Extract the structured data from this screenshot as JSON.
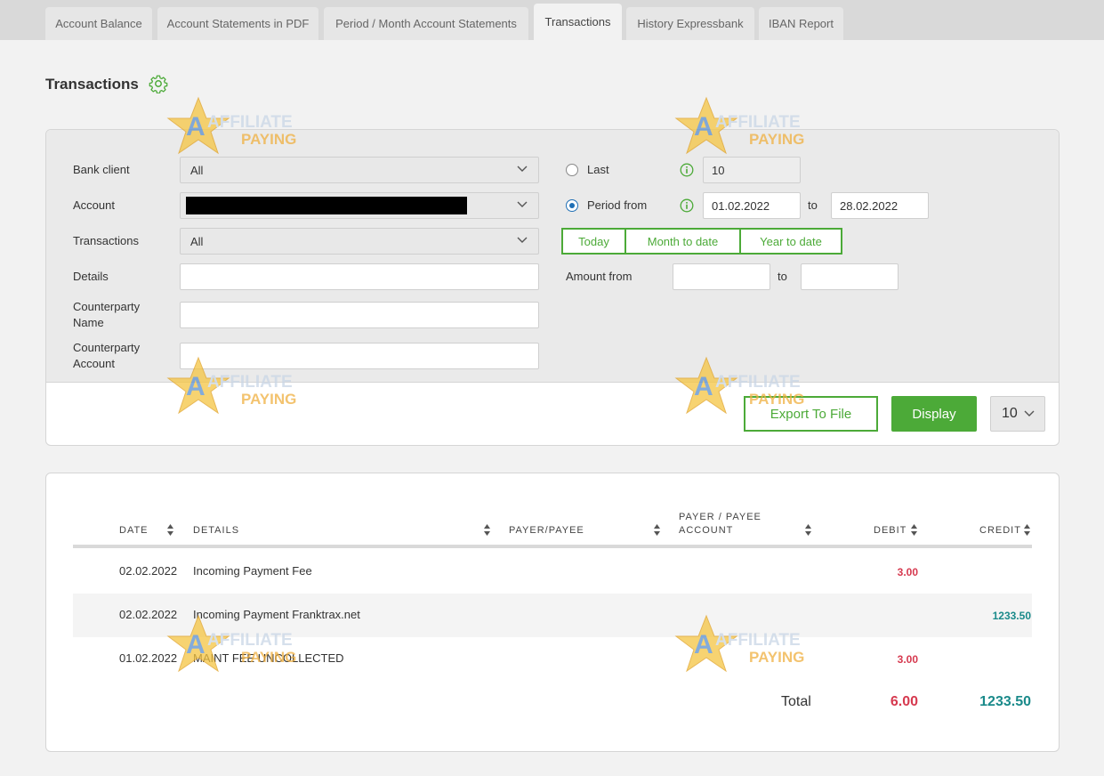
{
  "tabs": [
    {
      "label": "Account Balance"
    },
    {
      "label": "Account Statements in PDF"
    },
    {
      "label": "Period / Month Account Statements"
    },
    {
      "label": "Transactions"
    },
    {
      "label": "History Expressbank"
    },
    {
      "label": "IBAN Report"
    }
  ],
  "page_title": "Transactions",
  "filters": {
    "bank_client": {
      "label": "Bank client",
      "value": "All"
    },
    "account": {
      "label": "Account",
      "value": ""
    },
    "transactions": {
      "label": "Transactions",
      "value": "All"
    },
    "details": {
      "label": "Details",
      "value": ""
    },
    "counterparty_name": {
      "label_1": "Counterparty",
      "label_2": "Name",
      "value": ""
    },
    "counterparty_account": {
      "label_1": "Counterparty",
      "label_2": "Account",
      "value": ""
    },
    "last": {
      "label": "Last",
      "value": "10",
      "selected": false
    },
    "period": {
      "label": "Period from",
      "from": "01.02.2022",
      "to_label": "to",
      "to": "28.02.2022",
      "selected": true
    },
    "quick": {
      "today": "Today",
      "month_to_date": "Month to date",
      "year_to_date": "Year to date"
    },
    "amount": {
      "label": "Amount from",
      "to_label": "to",
      "from": "",
      "to": ""
    }
  },
  "actions": {
    "export": "Export To File",
    "display": "Display",
    "page_size": "10"
  },
  "table": {
    "headers": {
      "date": "Date",
      "details": "Details",
      "payer": "Payer/Payee",
      "payer_account_1": "Payer / Payee",
      "payer_account_2": "Account",
      "debit": "Debit",
      "credit": "Credit"
    },
    "rows": [
      {
        "date": "02.02.2022",
        "details": "Incoming Payment Fee",
        "payer": "",
        "payer_account": "",
        "debit": "3.00",
        "credit": ""
      },
      {
        "date": "02.02.2022",
        "details": "Incoming Payment Franktrax.net",
        "payer": "",
        "payer_account": "",
        "debit": "",
        "credit": "1233.50"
      },
      {
        "date": "01.02.2022",
        "details": "MAINT FEE UNCOLLECTED",
        "payer": "",
        "payer_account": "",
        "debit": "3.00",
        "credit": ""
      }
    ],
    "total": {
      "label": "Total",
      "debit": "6.00",
      "credit": "1233.50"
    }
  },
  "watermark": {
    "line1": "AFFILIATE",
    "line2": "PAYING"
  },
  "colors": {
    "accent": "#4caa38",
    "debit": "#d6394f",
    "credit": "#1a8a8a",
    "radio": "#1f6fb5"
  }
}
